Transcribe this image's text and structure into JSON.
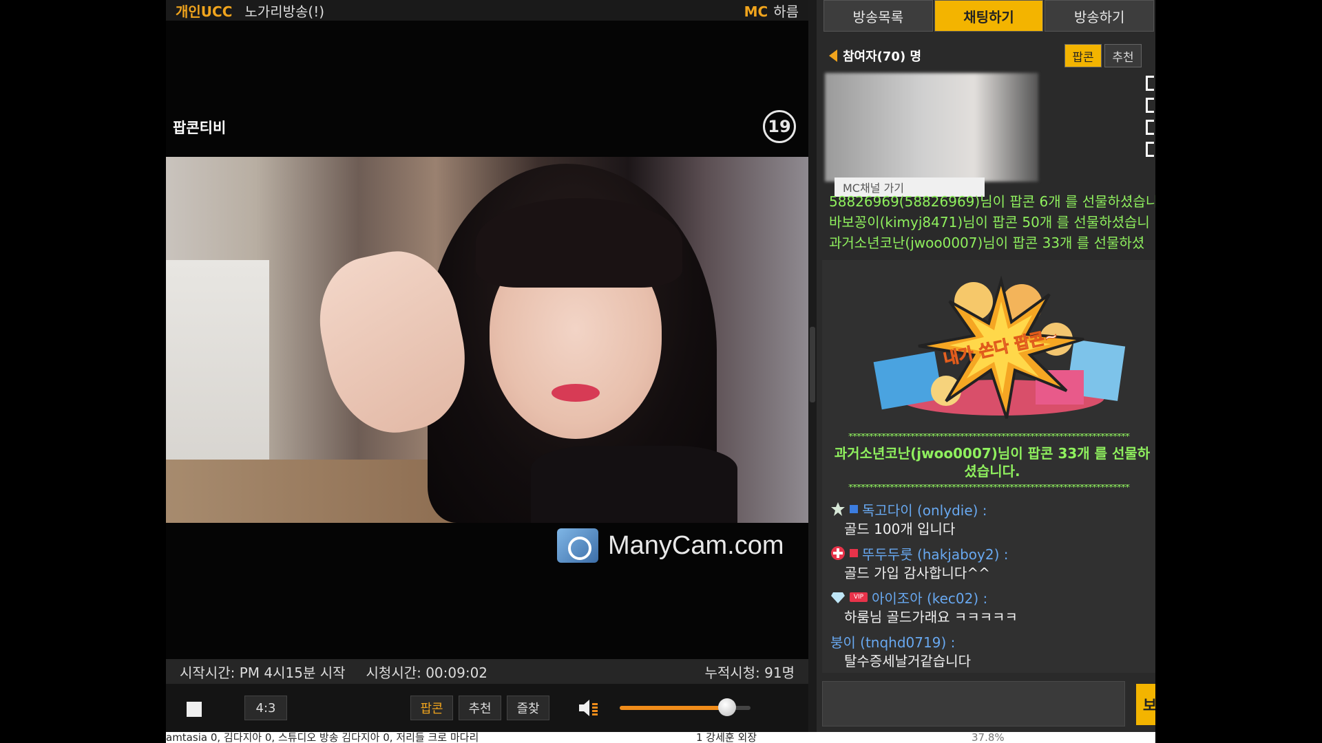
{
  "player": {
    "category": "개인UCC",
    "title": "노가리방송(!)",
    "mc_label": "MC",
    "mc_name": "하름",
    "channel_label": "팝콘티비",
    "age_badge": "19",
    "watermark": "ManyCam.com",
    "info": {
      "start": "시작시간: PM 4시15분 시작",
      "watch": "시청시간: 00:09:02",
      "total": "누적시청: 91명"
    },
    "controls": {
      "ratio": "4:3",
      "popcorn": "팝콘",
      "recommend": "추천",
      "favorite": "즐찾",
      "volume_percent": 82
    }
  },
  "panel": {
    "tabs": [
      {
        "label": "방송목록"
      },
      {
        "label": "채팅하기"
      },
      {
        "label": "방송하기"
      }
    ],
    "participants": "참여자(70) 명",
    "btn_popcorn": "팝콘",
    "btn_recommend": "추천",
    "mc_channel": "MC채널 가기",
    "gift_log": [
      "58826969(58826969)님이 팝콘 6개 를 선물하셨습니",
      "바보꽁이(kimyj8471)님이 팝콘 50개 를 선물하셨습니",
      "과거소년코난(jwoo0007)님이 팝콘 33개 를 선물하셨"
    ],
    "burst_text": "내가 쏜다 팝콘~",
    "notice": "과거소년코난(jwoo0007)님이 팝콘 33개 를 선물하셨습니다.",
    "stars": "********************************************************************",
    "messages": [
      {
        "user": "독고다이 (onlydie) :",
        "text": "골드 100개 입니다",
        "icon": "star-icon"
      },
      {
        "user": "뚜두두룻 (hakjaboy2) :",
        "text": "골드 가입 감사합니다^^",
        "icon": "cross-icon"
      },
      {
        "user": "아이조아 (kec02) :",
        "text": "하룸님 골드가래요 ㅋㅋㅋㅋㅋ",
        "icon": "diamond-icon",
        "vip": "VIP"
      },
      {
        "user": "붕이 (tnqhd0719) :",
        "text": "탈수증세날거같습니다"
      }
    ],
    "send_label": "보"
  },
  "bottom_strip": {
    "left": "amtasia 0, 김다지아 0, 스튜디오 방송 김다지아 0, 저리들 크로 마다리",
    "mid": "1    강세훈 외장",
    "right": "37.8%"
  },
  "colors": {
    "accent": "#f3b400",
    "gift_green": "#8ff05e",
    "user_blue": "#68a8f0"
  }
}
